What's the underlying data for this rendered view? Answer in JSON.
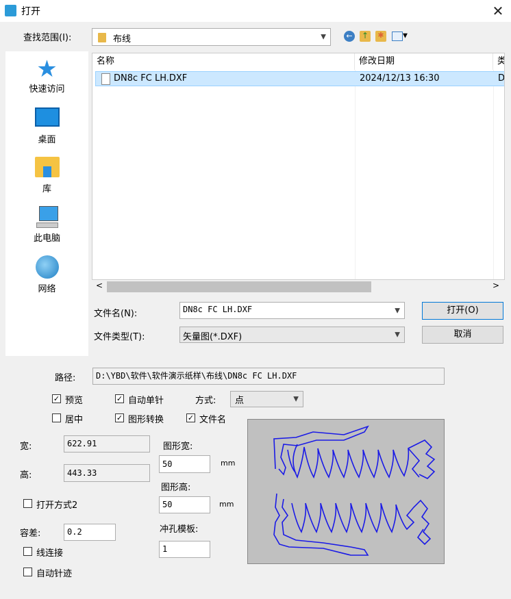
{
  "window": {
    "title": "打开",
    "close_glyph": "✕"
  },
  "lookin": {
    "label": "查找范围(I):",
    "value": "布线"
  },
  "places": [
    {
      "label": "快速访问",
      "icon": "star-icon"
    },
    {
      "label": "桌面",
      "icon": "desktop-icon"
    },
    {
      "label": "库",
      "icon": "library-icon"
    },
    {
      "label": "此电脑",
      "icon": "computer-icon"
    },
    {
      "label": "网络",
      "icon": "network-icon"
    }
  ],
  "filelist": {
    "columns": [
      "名称",
      "修改日期",
      "类"
    ],
    "rows": [
      {
        "name": "DN8c FC LH.DXF",
        "date": "2024/12/13 16:30",
        "type": "D"
      }
    ]
  },
  "filename": {
    "label": "文件名(N):",
    "value": "DN8c FC LH.DXF"
  },
  "filetype": {
    "label": "文件类型(T):",
    "value": "矢量图(*.DXF)"
  },
  "buttons": {
    "open": "打开(O)",
    "cancel": "取消"
  },
  "path": {
    "label": "路径:",
    "value": "D:\\YBD\\软件\\软件演示纸样\\布线\\DN8c FC LH.DXF"
  },
  "options": {
    "preview": {
      "label": "预览",
      "checked": true
    },
    "auto_single": {
      "label": "自动单针",
      "checked": true
    },
    "mode_label": "方式:",
    "mode_value": "点",
    "center": {
      "label": "居中",
      "checked": false
    },
    "shape_convert": {
      "label": "图形转换",
      "checked": true
    },
    "file_name": {
      "label": "文件名",
      "checked": true
    }
  },
  "dims": {
    "width_label": "宽:",
    "width_value": "622.91",
    "height_label": "高:",
    "height_value": "443.33",
    "shape_w_label": "图形宽:",
    "shape_w_value": "50",
    "unit1": "mm",
    "shape_h_label": "图形高:",
    "shape_h_value": "50",
    "unit2": "mm",
    "open_mode2": {
      "label": "打开方式2",
      "checked": false
    },
    "tolerance_label": "容差:",
    "tolerance_value": "0.2",
    "punch_label": "冲孔模板:",
    "punch_value": "1",
    "line_connect": {
      "label": "线连接",
      "checked": false
    },
    "auto_trace": {
      "label": "自动针迹",
      "checked": false
    }
  },
  "colors": {
    "accent": "#0078d7",
    "preview_line": "#1a1ae6",
    "selection": "#cce8ff"
  }
}
